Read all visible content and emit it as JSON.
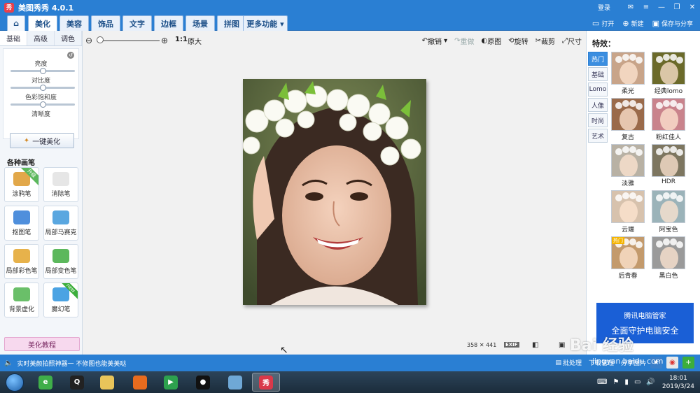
{
  "app": {
    "title": "美图秀秀 4.0.1",
    "logo": "秀",
    "login": "登录"
  },
  "window_controls": {
    "message": "✉",
    "menu": "≡",
    "minimize": "—",
    "maximize": "❐",
    "close": "✕"
  },
  "tabs": [
    {
      "label": "⌂"
    },
    {
      "label": "美化"
    },
    {
      "label": "美容"
    },
    {
      "label": "饰品"
    },
    {
      "label": "文字"
    },
    {
      "label": "边框"
    },
    {
      "label": "场景"
    },
    {
      "label": "拼图"
    },
    {
      "label": "更多功能 ▾"
    }
  ],
  "menu_right": {
    "open": "打开",
    "new": "新建",
    "save_share": "保存与分享"
  },
  "left_panel": {
    "subtabs": [
      "基础",
      "高级",
      "调色"
    ],
    "sliders": [
      {
        "label": "亮度",
        "value": 0.5
      },
      {
        "label": "对比度",
        "value": 0.5
      },
      {
        "label": "色彩饱和度",
        "value": 0.5
      },
      {
        "label": "清晰度",
        "value": 0.5
      }
    ],
    "one_click": "一键美化",
    "brush_title": "各种画笔",
    "brushes": [
      {
        "label": "涂鸦笔",
        "ribbon": "升级",
        "icon": "pencil-icon",
        "color": "#e2a84a"
      },
      {
        "label": "消除笔",
        "ribbon": "",
        "icon": "eraser-icon",
        "color": "#e6e6e6"
      },
      {
        "label": "抠图笔",
        "ribbon": "",
        "icon": "cutout-pen-icon",
        "color": "#4f8fdc"
      },
      {
        "label": "局部马赛克",
        "ribbon": "",
        "icon": "mosaic-icon",
        "color": "#5aa7e0"
      },
      {
        "label": "局部彩色笔",
        "ribbon": "",
        "icon": "color-brush-icon",
        "color": "#e7b24b"
      },
      {
        "label": "局部变色笔",
        "ribbon": "",
        "icon": "paint-bucket-icon",
        "color": "#5cb85c"
      },
      {
        "label": "背景虚化",
        "ribbon": "",
        "icon": "blur-icon",
        "color": "#6abf69"
      },
      {
        "label": "魔幻笔",
        "ribbon": "new",
        "icon": "magic-pen-icon",
        "color": "#4ba3e3"
      }
    ],
    "tutorial": "美化教程"
  },
  "toolbar": {
    "ratio": "1:1",
    "original_size": "原大",
    "undo": "撤销",
    "redo": "重做",
    "original": "原图",
    "rotate": "旋转",
    "crop": "裁剪",
    "resize": "尺寸"
  },
  "image_info": {
    "width": "358",
    "times": "✕",
    "height": "441",
    "exif": "EXIF"
  },
  "effects": {
    "title": "特效：",
    "categories": [
      "热门",
      "基础",
      "Lomo",
      "人像",
      "时尚",
      "艺术"
    ],
    "items": [
      {
        "label": "柔光",
        "tone": "#c8a489",
        "badge": ""
      },
      {
        "label": "经典lomo",
        "tone": "#6b6a2a",
        "badge": ""
      },
      {
        "label": "复古",
        "tone": "#9a6a4a",
        "badge": ""
      },
      {
        "label": "粉红佳人",
        "tone": "#c9838c",
        "badge": ""
      },
      {
        "label": "淡雅",
        "tone": "#b8b1a4",
        "badge": ""
      },
      {
        "label": "HDR",
        "tone": "#7d7660",
        "badge": ""
      },
      {
        "label": "云端",
        "tone": "#d7c2ad",
        "badge": ""
      },
      {
        "label": "阿宝色",
        "tone": "#9bb3b9",
        "badge": ""
      },
      {
        "label": "后青春",
        "tone": "#c39a6c",
        "badge": "热门"
      },
      {
        "label": "黑白色",
        "tone": "#9a9a9a",
        "badge": ""
      }
    ]
  },
  "ad": {
    "line1": "腾讯电脑管家",
    "line2": "全面守护电脑安全"
  },
  "statusbar": {
    "tip": "实时美颜拍照神器一 不修图也能美美哒",
    "batch": "批处理",
    "download": "下载管理",
    "share": "分享图片"
  },
  "watermark": {
    "brand": "Bai 经验",
    "url": "jingyan.baidu.com"
  },
  "taskbar": {
    "apps": [
      {
        "name": "browser-360-icon",
        "color": "#3fae49",
        "glyph": "e"
      },
      {
        "name": "qq-icon",
        "color": "#222222",
        "glyph": "Q"
      },
      {
        "name": "file-explorer-icon",
        "color": "#e8c45a",
        "glyph": ""
      },
      {
        "name": "firefox-icon",
        "color": "#e76b1e",
        "glyph": ""
      },
      {
        "name": "media-player-icon",
        "color": "#2da14e",
        "glyph": "▶"
      },
      {
        "name": "record-icon",
        "color": "#111111",
        "glyph": "●"
      },
      {
        "name": "app-window-icon",
        "color": "#6fa8d6",
        "glyph": ""
      },
      {
        "name": "meitu-taskbar-icon",
        "color": "#d9394a",
        "glyph": "秀"
      }
    ],
    "time": "18:01",
    "date": "2019/3/24"
  }
}
